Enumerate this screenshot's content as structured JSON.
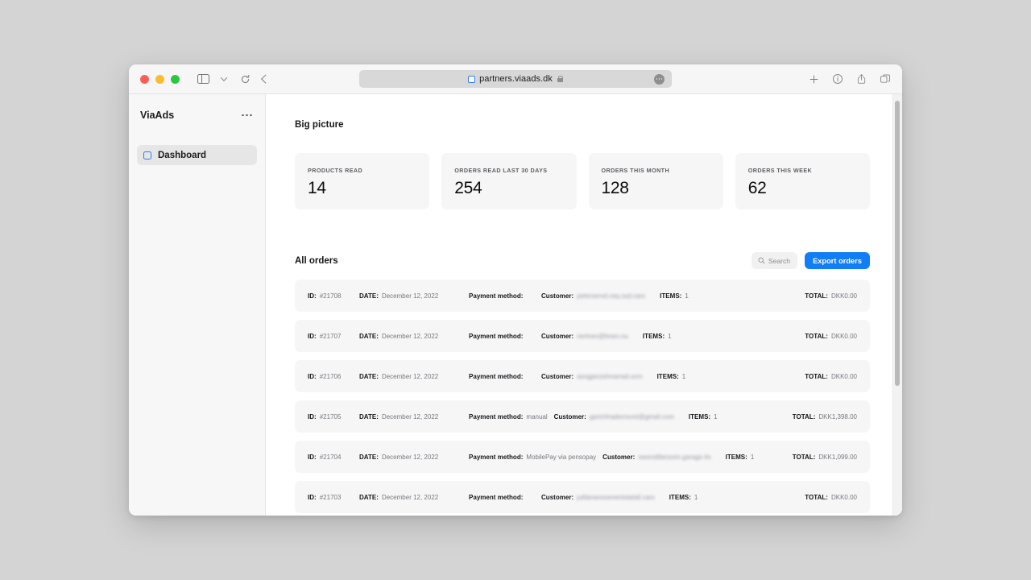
{
  "browser": {
    "url": "partners.viaads.dk",
    "favicon_icon": "blue-square-favicon",
    "lock_icon": "lock-icon",
    "traffic_lights": [
      "close",
      "minimize",
      "maximize"
    ],
    "toolbar_left_icons": [
      "sidebar-toggle-icon",
      "chevron-down-icon",
      "reload-icon",
      "back-icon"
    ],
    "toolbar_right_icons": [
      "new-tab-icon",
      "info-icon",
      "share-icon",
      "tab-overview-icon"
    ]
  },
  "sidebar": {
    "title": "ViaAds",
    "more_icon": "ellipsis-icon",
    "items": [
      {
        "label": "Dashboard",
        "icon": "dashboard-square-icon",
        "active": true
      }
    ]
  },
  "main": {
    "big_picture_title": "Big picture",
    "stats": [
      {
        "label": "PRODUCTS READ",
        "value": "14"
      },
      {
        "label": "ORDERS READ LAST 30 DAYS",
        "value": "254"
      },
      {
        "label": "ORDERS THIS MONTH",
        "value": "128"
      },
      {
        "label": "ORDERS THIS WEEK",
        "value": "62"
      }
    ],
    "orders": {
      "title": "All orders",
      "search_placeholder": "Search",
      "search_icon": "search-icon",
      "export_label": "Export orders",
      "export_color": "#127ef6",
      "labels": {
        "id": "ID:",
        "date": "DATE:",
        "payment": "Payment method:",
        "customer": "Customer:",
        "items": "ITEMS:",
        "total": "TOTAL:"
      },
      "rows": [
        {
          "id": "#21708",
          "date": "December 12, 2022",
          "payment": "",
          "customer": "peterservd.ceq.ssd.cars",
          "items": "1",
          "total": "DKK0.00"
        },
        {
          "id": "#21707",
          "date": "December 12, 2022",
          "payment": "",
          "customer": "nerlnen@bnen.nu",
          "items": "1",
          "total": "DKK0.00"
        },
        {
          "id": "#21706",
          "date": "December 12, 2022",
          "payment": "",
          "customer": "asogjanzehnamail.xcm",
          "items": "1",
          "total": "DKK0.00"
        },
        {
          "id": "#21705",
          "date": "December 12, 2022",
          "payment": "manual",
          "customer": "garichhademsvst@gmail.com",
          "items": "1",
          "total": "DKK1,398.00"
        },
        {
          "id": "#21704",
          "date": "December 12, 2022",
          "payment": "MobilePay via pensopay",
          "customer": "sworstillansom.garage.#s",
          "items": "1",
          "total": "DKK1,099.00"
        },
        {
          "id": "#21703",
          "date": "December 12, 2022",
          "payment": "",
          "customer": "juttlananssenentstatall.cars",
          "items": "1",
          "total": "DKK0.00"
        }
      ]
    }
  }
}
